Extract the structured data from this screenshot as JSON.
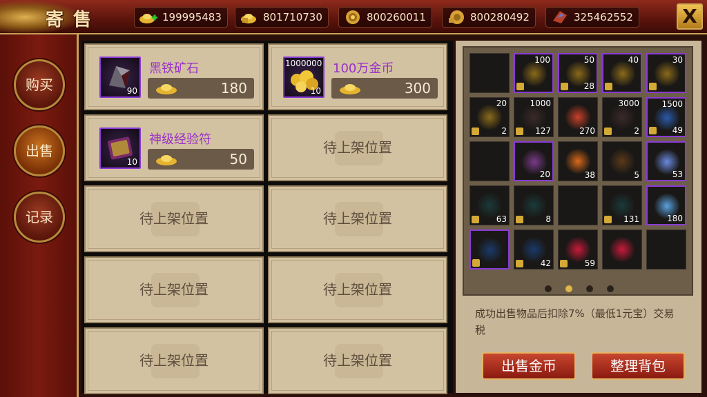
{
  "header": {
    "title": "寄售",
    "currencies": [
      {
        "icon": "gold-ingot-plus-icon",
        "value": "199995483"
      },
      {
        "icon": "locked-ingot-icon",
        "value": "801710730"
      },
      {
        "icon": "coin-icon",
        "value": "800260011"
      },
      {
        "icon": "locked-coin-icon",
        "value": "800280492"
      },
      {
        "icon": "red-crystal-icon",
        "value": "325462552"
      }
    ],
    "close_label": "X"
  },
  "sidebar": {
    "items": [
      {
        "label": "购买",
        "active": false
      },
      {
        "label": "出售",
        "active": true
      },
      {
        "label": "记录",
        "active": false
      }
    ]
  },
  "listings": {
    "placeholder": "待上架位置",
    "items": [
      {
        "name": "黑铁矿石",
        "count": "90",
        "top_count": "",
        "price": "180",
        "icon": "black-iron-ore-icon"
      },
      {
        "name": "100万金币",
        "count": "10",
        "top_count": "1000000",
        "price": "300",
        "icon": "gold-coins-pile-icon"
      },
      {
        "name": "神级经验符",
        "count": "10",
        "top_count": "",
        "price": "50",
        "icon": "exp-talisman-icon"
      }
    ]
  },
  "inventory": {
    "cells": [
      {
        "top": "",
        "bottom": "",
        "locked": false,
        "purple": false,
        "icon": ""
      },
      {
        "top": "100",
        "bottom": "",
        "locked": true,
        "purple": true,
        "icon": "ingot-icon"
      },
      {
        "top": "50",
        "bottom": "28",
        "locked": true,
        "purple": true,
        "icon": "ingot-icon"
      },
      {
        "top": "40",
        "bottom": "",
        "locked": true,
        "purple": true,
        "icon": "ingot-icon"
      },
      {
        "top": "30",
        "bottom": "",
        "locked": true,
        "purple": true,
        "icon": "ingot-icon"
      },
      {
        "top": "20",
        "bottom": "2",
        "locked": true,
        "purple": false,
        "icon": "ingot-icon"
      },
      {
        "top": "1000",
        "bottom": "127",
        "locked": true,
        "purple": false,
        "icon": "ore-icon"
      },
      {
        "top": "",
        "bottom": "270",
        "locked": false,
        "purple": false,
        "icon": "gem-cluster-icon"
      },
      {
        "top": "3000",
        "bottom": "2",
        "locked": true,
        "purple": false,
        "icon": "ore-icon"
      },
      {
        "top": "1500",
        "bottom": "49",
        "locked": true,
        "purple": true,
        "icon": "blue-scroll-icon"
      },
      {
        "top": "",
        "bottom": "",
        "locked": false,
        "purple": false,
        "icon": ""
      },
      {
        "top": "",
        "bottom": "20",
        "locked": false,
        "purple": true,
        "icon": "exp-talisman-icon"
      },
      {
        "top": "",
        "bottom": "38",
        "locked": false,
        "purple": false,
        "icon": "fire-crystal-icon"
      },
      {
        "top": "",
        "bottom": "5",
        "locked": false,
        "purple": false,
        "icon": "dark-orb-icon"
      },
      {
        "top": "",
        "bottom": "53",
        "locked": false,
        "purple": true,
        "icon": "blue-gem-icon"
      },
      {
        "top": "",
        "bottom": "63",
        "locked": true,
        "purple": false,
        "icon": "dark-ore-icon"
      },
      {
        "top": "",
        "bottom": "8",
        "locked": true,
        "purple": false,
        "icon": "dark-ore-icon"
      },
      {
        "top": "",
        "bottom": "",
        "locked": false,
        "purple": false,
        "icon": ""
      },
      {
        "top": "",
        "bottom": "131",
        "locked": true,
        "purple": false,
        "icon": "dark-ore-icon"
      },
      {
        "top": "",
        "bottom": "180",
        "locked": false,
        "purple": true,
        "icon": "blue-crystal-icon"
      },
      {
        "top": "",
        "bottom": "",
        "locked": true,
        "purple": true,
        "icon": "blue-potion-icon"
      },
      {
        "top": "",
        "bottom": "42",
        "locked": true,
        "purple": false,
        "icon": "blue-potion-icon"
      },
      {
        "top": "",
        "bottom": "59",
        "locked": true,
        "purple": false,
        "icon": "red-potion-icon"
      },
      {
        "top": "",
        "bottom": "",
        "locked": false,
        "purple": false,
        "icon": "red-potion-icon"
      },
      {
        "top": "",
        "bottom": "",
        "locked": false,
        "purple": false,
        "icon": ""
      }
    ],
    "pages": 4,
    "active_page": 1
  },
  "tax_text": "成功出售物品后扣除7%（最低1元宝）交易税",
  "buttons": {
    "sell_gold": "出售金币",
    "tidy_bag": "整理背包"
  }
}
